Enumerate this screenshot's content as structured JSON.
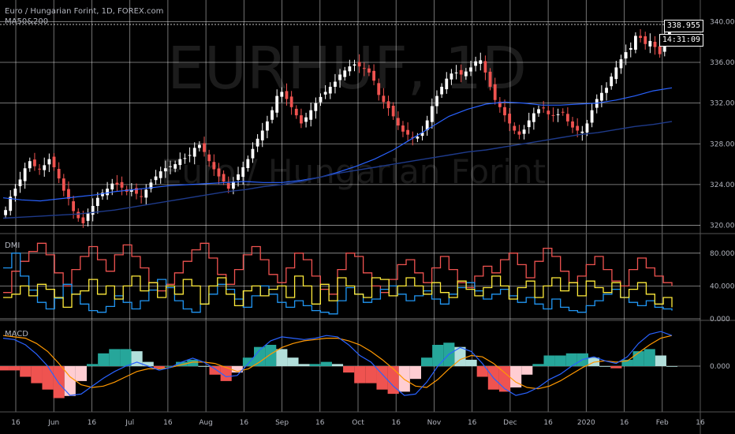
{
  "header": {
    "symbol_line": "Euro / Hungarian Forint, 1D, FOREX.com",
    "indicator_line": "MA50&200"
  },
  "watermark": {
    "symbol": "EURHUF, 1D",
    "name": "Euro / Hungarian Forint"
  },
  "current_price": "338.955",
  "countdown": "14:31:09",
  "panes": {
    "dmi_label": "DMI",
    "macd_label": "MACD"
  },
  "colors": {
    "background": "#000000",
    "grid": "#ffffff",
    "candle_up": "#ffffff",
    "candle_down": "#ef5350",
    "ma50": "#2962ff",
    "ma200": "#1e3a8a",
    "dmi_plus": "#2196f3",
    "dmi_minus": "#ef5350",
    "adx": "#ffeb3b",
    "macd_line": "#2962ff",
    "signal_line": "#ff9800",
    "hist_up_strong": "#26a69a",
    "hist_up_weak": "#b2dfdb",
    "hist_down_strong": "#ef5350",
    "hist_down_weak": "#ffcdd2"
  },
  "chart_data": [
    {
      "type": "candlestick",
      "title": "EURHUF, 1D",
      "x_ticks": [
        "16",
        "Jun",
        "16",
        "Jul",
        "16",
        "Aug",
        "16",
        "Sep",
        "16",
        "Oct",
        "16",
        "Nov",
        "16",
        "Dec",
        "16",
        "2020",
        "16",
        "Feb",
        "16"
      ],
      "y_ticks": [
        "320.000",
        "324.000",
        "328.000",
        "332.000",
        "336.000",
        "340.000"
      ],
      "ylim": [
        319.5,
        341.5
      ],
      "close": [
        321.5,
        322.8,
        323.6,
        324.5,
        325.6,
        326.3,
        325.8,
        325.5,
        325.9,
        326.5,
        325.7,
        324.6,
        323.4,
        322.6,
        321.4,
        320.7,
        320.2,
        321.2,
        321.9,
        322.7,
        323.2,
        323.6,
        324.1,
        324.0,
        323.7,
        323.3,
        323.5,
        323.1,
        322.8,
        323.5,
        324.2,
        324.8,
        325.3,
        325.6,
        325.8,
        326.0,
        326.5,
        326.6,
        326.9,
        327.6,
        327.9,
        327.2,
        326.3,
        325.5,
        324.8,
        324.3,
        323.6,
        324.3,
        325.0,
        325.7,
        326.5,
        327.5,
        328.5,
        329.3,
        330.2,
        331.3,
        332.7,
        333.1,
        332.4,
        331.6,
        330.8,
        330.0,
        330.6,
        331.3,
        332.0,
        332.6,
        333.1,
        333.6,
        334.1,
        334.8,
        335.2,
        335.6,
        335.8,
        335.6,
        335.4,
        335.0,
        334.2,
        332.8,
        332.1,
        331.5,
        330.7,
        329.8,
        329.2,
        328.9,
        328.6,
        328.7,
        329.1,
        330.3,
        331.7,
        332.7,
        333.6,
        334.4,
        334.9,
        335.0,
        334.8,
        335.1,
        335.5,
        336.1,
        336.2,
        335.0,
        333.6,
        332.3,
        331.6,
        330.8,
        330.0,
        329.3,
        328.9,
        329.4,
        330.3,
        331.0,
        331.4,
        331.5,
        330.9,
        330.8,
        330.9,
        331.1,
        330.2,
        329.6,
        329.3,
        329.2,
        330.0,
        331.3,
        332.4,
        333.0,
        333.5,
        334.6,
        335.5,
        336.3,
        337.0,
        337.4,
        338.6,
        338.4,
        337.8,
        338.1,
        337.5,
        336.8,
        338.3,
        338.96
      ],
      "ma50": [
        322.7,
        322.5,
        322.4,
        322.6,
        322.8,
        323.0,
        323.3,
        323.5,
        323.7,
        323.9,
        324.0,
        324.1,
        324.2,
        324.3,
        324.2,
        324.2,
        324.4,
        324.7,
        325.2,
        325.8,
        326.5,
        327.4,
        328.5,
        329.6,
        330.7,
        331.4,
        331.9,
        332.1,
        332.0,
        331.8,
        331.8,
        331.9,
        332.0,
        332.3,
        332.7,
        333.2,
        333.5
      ],
      "ma200": [
        320.7,
        320.8,
        320.9,
        321.0,
        321.1,
        321.3,
        321.5,
        321.8,
        322.1,
        322.4,
        322.7,
        323.0,
        323.3,
        323.5,
        323.8,
        324.0,
        324.3,
        324.7,
        325.1,
        325.4,
        325.7,
        326.0,
        326.3,
        326.6,
        326.9,
        327.2,
        327.4,
        327.7,
        328.0,
        328.3,
        328.6,
        328.9,
        329.1,
        329.4,
        329.7,
        329.9,
        330.2
      ]
    },
    {
      "type": "line",
      "title": "DMI",
      "y_ticks": [
        "0.000",
        "40.000",
        "80.000"
      ],
      "ylim": [
        0,
        100
      ],
      "series": [
        {
          "values": [
            62,
            80,
            52,
            35,
            20,
            12,
            25,
            42,
            30,
            18,
            10,
            8,
            15,
            28,
            20,
            12,
            22,
            35,
            48,
            38,
            22,
            12,
            8,
            18,
            30,
            42,
            36,
            24,
            14,
            28,
            40,
            30,
            20,
            14,
            22,
            16,
            10,
            8,
            6,
            22,
            38,
            30,
            20,
            24,
            36,
            40,
            30,
            22,
            28,
            34,
            24,
            18,
            30,
            38,
            44,
            34,
            24,
            30,
            36,
            28,
            20,
            26,
            18,
            12,
            24,
            14,
            10,
            8,
            16,
            22,
            30,
            36,
            26,
            20,
            16,
            22,
            14,
            12,
            10
          ]
        },
        {
          "values": [
            32,
            58,
            70,
            82,
            92,
            78,
            56,
            40,
            60,
            76,
            88,
            72,
            58,
            78,
            90,
            76,
            62,
            44,
            34,
            42,
            56,
            70,
            84,
            92,
            74,
            54,
            42,
            60,
            78,
            88,
            72,
            54,
            44,
            62,
            80,
            72,
            52,
            36,
            30,
            60,
            80,
            76,
            56,
            40,
            32,
            48,
            66,
            72,
            56,
            44,
            62,
            76,
            60,
            44,
            38,
            52,
            64,
            56,
            72,
            80,
            66,
            50,
            70,
            86,
            76,
            58,
            44,
            52,
            66,
            76,
            60,
            46,
            40,
            60,
            74,
            62,
            52,
            44,
            40
          ]
        },
        {
          "values": [
            26,
            30,
            40,
            28,
            42,
            36,
            26,
            14,
            30,
            34,
            48,
            30,
            40,
            24,
            40,
            52,
            34,
            44,
            26,
            40,
            30,
            48,
            40,
            18,
            40,
            50,
            30,
            16,
            34,
            40,
            28,
            36,
            40,
            26,
            52,
            40,
            18,
            42,
            22,
            50,
            40,
            30,
            26,
            50,
            48,
            28,
            40,
            50,
            40,
            30,
            44,
            32,
            26,
            46,
            36,
            28,
            38,
            52,
            40,
            24,
            38,
            46,
            26,
            40,
            50,
            34,
            44,
            28,
            46,
            38,
            32,
            44,
            26,
            36,
            44,
            30,
            18,
            26,
            14
          ]
        }
      ]
    },
    {
      "type": "line",
      "title": "MACD",
      "y_ticks": [
        "0.000"
      ],
      "ylim": [
        -3.2,
        3.2
      ],
      "series": [
        {
          "values": [
            2.1,
            2.0,
            1.6,
            0.9,
            0.0,
            -1.3,
            -2.2,
            -2.1,
            -1.5,
            -0.9,
            -0.4,
            0.0,
            0.3,
            0.0,
            -0.3,
            -0.1,
            0.3,
            0.6,
            0.3,
            -0.2,
            -0.8,
            -0.7,
            0.2,
            1.2,
            1.9,
            2.2,
            2.1,
            2.0,
            2.1,
            2.3,
            2.2,
            1.6,
            0.8,
            0.3,
            -0.6,
            -1.5,
            -2.2,
            -2.1,
            -1.2,
            0.0,
            0.9,
            1.4,
            1.1,
            0.2,
            -0.9,
            -1.7,
            -2.2,
            -2.0,
            -1.6,
            -1.0,
            -0.6,
            0.0,
            0.5,
            0.7,
            0.4,
            0.2,
            0.7,
            1.7,
            2.4,
            2.6,
            2.3
          ]
        },
        {
          "values": [
            2.3,
            2.2,
            2.1,
            1.7,
            1.1,
            0.2,
            -0.8,
            -1.4,
            -1.6,
            -1.5,
            -1.2,
            -0.8,
            -0.4,
            -0.2,
            -0.2,
            -0.1,
            0.1,
            0.3,
            0.3,
            0.2,
            -0.1,
            -0.4,
            -0.2,
            0.3,
            0.9,
            1.4,
            1.7,
            1.9,
            2.0,
            2.1,
            2.1,
            1.9,
            1.6,
            1.1,
            0.5,
            -0.2,
            -1.0,
            -1.5,
            -1.6,
            -1.0,
            -0.2,
            0.5,
            0.8,
            0.7,
            0.2,
            -0.5,
            -1.2,
            -1.6,
            -1.7,
            -1.5,
            -1.1,
            -0.6,
            -0.1,
            0.3,
            0.4,
            0.3,
            0.4,
            1.0,
            1.6,
            2.1,
            2.3
          ]
        }
      ]
    }
  ]
}
